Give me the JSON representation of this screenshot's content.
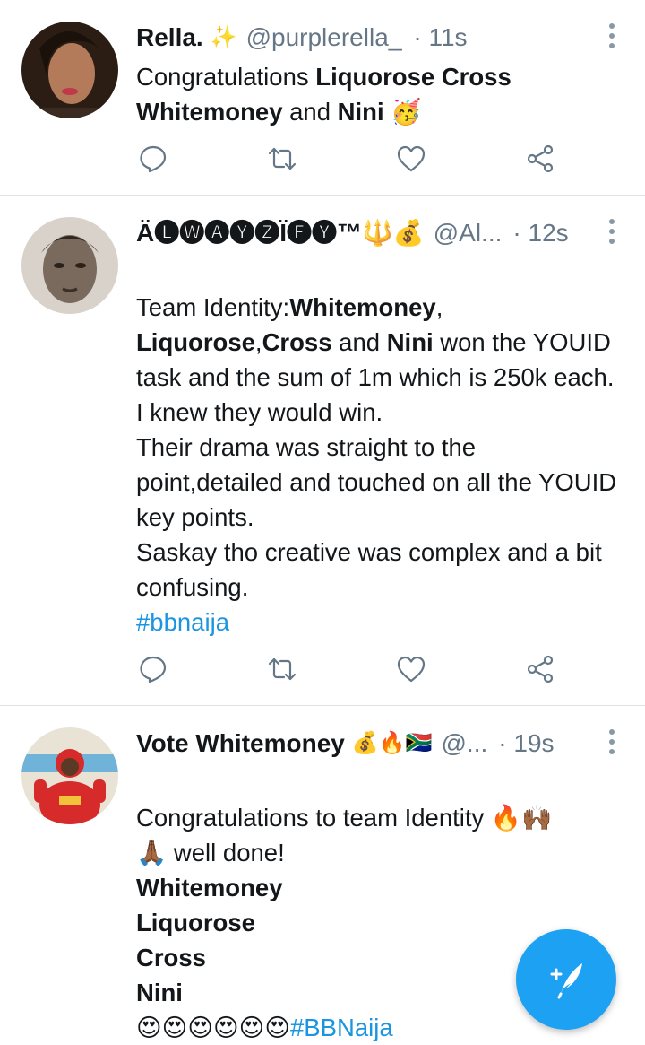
{
  "tweets": [
    {
      "name": "Rella.",
      "name_emoji": "✨",
      "handle": "@purplerella_",
      "time": "· 11s",
      "body": [
        {
          "text": "Congratulations ",
          "bold": false
        },
        {
          "text": "Liquorose Cross",
          "bold": true
        },
        {
          "text": " ",
          "bold": false
        },
        {
          "text": "Whitemoney",
          "bold": true
        },
        {
          "text": " and ",
          "bold": false
        },
        {
          "text": "Nini",
          "bold": true
        },
        {
          "text": " 🥳",
          "bold": false
        }
      ]
    },
    {
      "name": "Ä🅛🅦🅐🅨🅩Ï🅕🅨™🔱💰",
      "name_emoji": "",
      "handle": "@Al...",
      "time": "· 12s",
      "body": [
        {
          "text": "Team Identity:",
          "bold": false
        },
        {
          "text": "Whitemoney",
          "bold": true
        },
        {
          "text": ", ",
          "bold": false
        },
        {
          "text": "Liquorose",
          "bold": true
        },
        {
          "text": ",",
          "bold": false
        },
        {
          "text": "Cross",
          "bold": true
        },
        {
          "text": " and ",
          "bold": false
        },
        {
          "text": "Nini",
          "bold": true
        },
        {
          "text": " won the YOUID task and the sum of 1m which is 250k each.\nI knew they would win.\nTheir drama was straight to the point,detailed and touched on all the YOUID key points.\nSaskay tho creative was complex and a bit confusing.\n",
          "bold": false
        },
        {
          "text": "#bbnaija",
          "bold": false,
          "tag": true
        }
      ]
    },
    {
      "name": "Vote Whitemoney",
      "name_emoji": "💰🔥🇿🇦",
      "handle": "@...",
      "time": "· 19s",
      "body": [
        {
          "text": "Congratulations to team Identity 🔥🙌🏾\n🙏🏾 well done!\n",
          "bold": false
        },
        {
          "text": "Whitemoney\nLiquorose\nCross\nNini",
          "bold": true
        },
        {
          "text": "\n😍😍😍😍😍😍",
          "bold": false
        },
        {
          "text": "#BBNaija",
          "bold": false,
          "tag": true
        }
      ]
    }
  ],
  "actions": [
    "reply-icon",
    "retweet-icon",
    "like-icon",
    "share-icon"
  ],
  "fab": {
    "icon": "compose-tweet-icon",
    "color": "#1da1f2"
  },
  "colors": {
    "hashtag": "#1b95e0",
    "secondary": "#657786",
    "divider": "#dfe3e6"
  }
}
